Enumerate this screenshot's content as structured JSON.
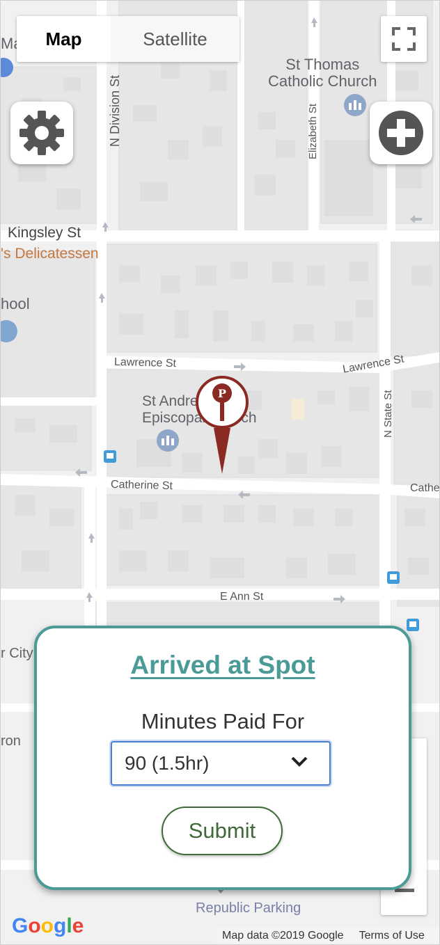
{
  "map": {
    "type_toggle": {
      "map_label": "Map",
      "satellite_label": "Satellite"
    },
    "streets": {
      "n_division": "N Division St",
      "kingsley": "Kingsley St",
      "elizabeth": "Elizabeth St",
      "lawrence_left": "Lawrence St",
      "lawrence_right": "Lawrence St",
      "n_state": "N State St",
      "catherine": "Catherine St",
      "catherine_right": "Cathe",
      "e_ann": "E Ann St"
    },
    "pois": {
      "church_top": "St Thomas\nCatholic Church",
      "church_mid": "St Andrew's\nEpiscopal Church",
      "deli": "'s Delicatessen",
      "school": "hool",
      "city": "r City",
      "ron": "ron",
      "parking": "Republic Parking",
      "left_edge_ma": "Ma"
    },
    "pin_letter": "P",
    "attribution": {
      "map_data": "Map data ©2019 Google",
      "terms": "Terms of Use"
    },
    "google_logo": [
      "G",
      "o",
      "o",
      "g",
      "l",
      "e"
    ],
    "logo_colors": [
      "#4285F4",
      "#EA4335",
      "#FBBC05",
      "#4285F4",
      "#34A853",
      "#EA4335"
    ]
  },
  "controls": {
    "settings_icon": "gear-icon",
    "add_icon": "plus-circle-icon",
    "fullscreen_icon": "fullscreen-icon"
  },
  "modal": {
    "title": "Arrived at Spot",
    "minutes_label": "Minutes Paid For",
    "minutes_value": "90 (1.5hr)",
    "submit_label": "Submit"
  },
  "colors": {
    "accent": "#4a9a96",
    "pin": "#8b2a22",
    "submit": "#3d6a36",
    "select_border": "#4a7fd1"
  }
}
